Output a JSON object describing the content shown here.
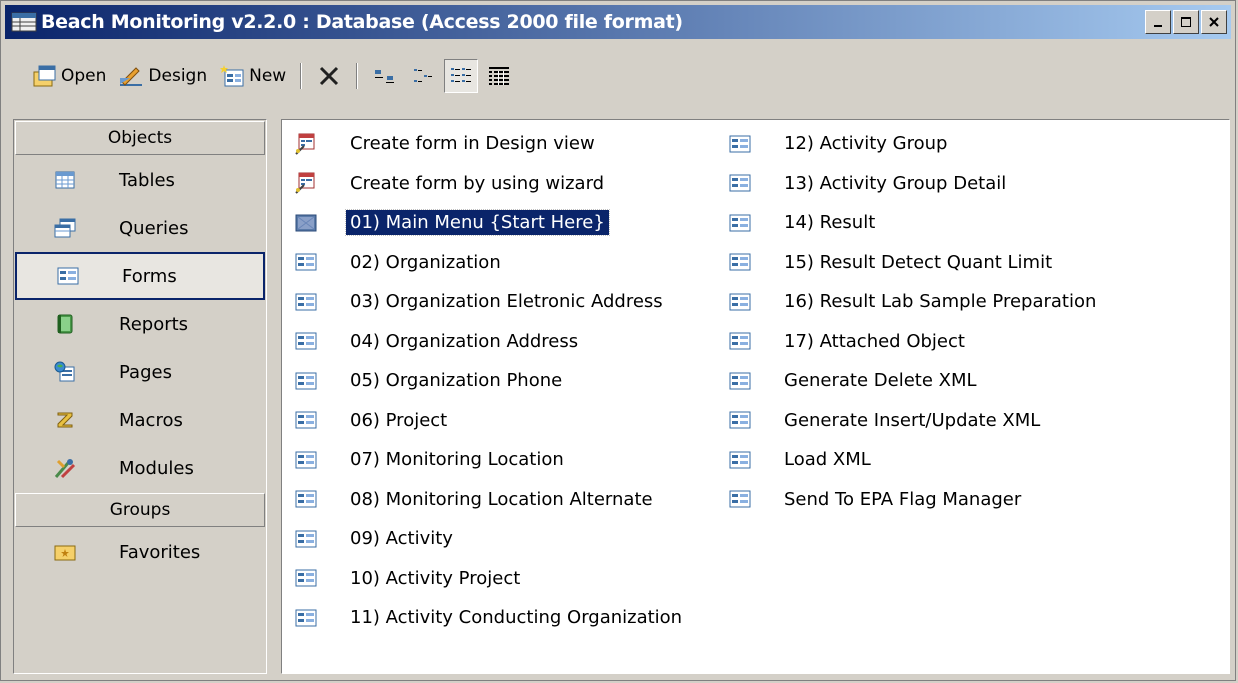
{
  "window": {
    "title": "Beach Monitoring v2.2.0 : Database (Access 2000 file format)",
    "controls": [
      "minimize",
      "maximize",
      "close"
    ]
  },
  "toolbar": {
    "open_label": "Open",
    "design_label": "Design",
    "new_label": "New",
    "icons": [
      "open-icon",
      "design-icon",
      "new-icon",
      "delete-icon",
      "large-icons-view-icon",
      "small-icons-view-icon",
      "list-view-icon",
      "details-view-icon"
    ],
    "active_view": "list"
  },
  "sidebar": {
    "objects_header": "Objects",
    "groups_header": "Groups",
    "items": [
      {
        "label": "Tables",
        "icon": "table-icon"
      },
      {
        "label": "Queries",
        "icon": "query-icon"
      },
      {
        "label": "Forms",
        "icon": "form-icon",
        "selected": true
      },
      {
        "label": "Reports",
        "icon": "report-icon"
      },
      {
        "label": "Pages",
        "icon": "page-icon"
      },
      {
        "label": "Macros",
        "icon": "macro-icon"
      },
      {
        "label": "Modules",
        "icon": "module-icon"
      }
    ],
    "groups": [
      {
        "label": "Favorites",
        "icon": "favorites-folder-icon"
      }
    ]
  },
  "list": {
    "column1": [
      {
        "label": "Create form in Design view",
        "icon": "wizard-icon"
      },
      {
        "label": "Create form by using wizard",
        "icon": "wizard-icon"
      },
      {
        "label": "01) Main Menu {Start Here}",
        "icon": "switchboard-form-icon",
        "selected": true
      },
      {
        "label": "02) Organization",
        "icon": "form-icon"
      },
      {
        "label": "03) Organization Eletronic Address",
        "icon": "form-icon"
      },
      {
        "label": "04) Organization Address",
        "icon": "form-icon"
      },
      {
        "label": "05) Organization Phone",
        "icon": "form-icon"
      },
      {
        "label": "06) Project",
        "icon": "form-icon"
      },
      {
        "label": "07) Monitoring Location",
        "icon": "form-icon"
      },
      {
        "label": "08) Monitoring Location Alternate",
        "icon": "form-icon"
      },
      {
        "label": "09) Activity",
        "icon": "form-icon"
      },
      {
        "label": "10) Activity Project",
        "icon": "form-icon"
      },
      {
        "label": "11) Activity Conducting Organization",
        "icon": "form-icon"
      }
    ],
    "column2": [
      {
        "label": "12) Activity Group",
        "icon": "form-icon"
      },
      {
        "label": "13) Activity Group Detail",
        "icon": "form-icon"
      },
      {
        "label": "14) Result",
        "icon": "form-icon"
      },
      {
        "label": "15) Result Detect Quant Limit",
        "icon": "form-icon"
      },
      {
        "label": "16) Result Lab Sample Preparation",
        "icon": "form-icon"
      },
      {
        "label": "17) Attached Object",
        "icon": "form-icon"
      },
      {
        "label": "Generate Delete XML",
        "icon": "form-icon"
      },
      {
        "label": "Generate Insert/Update XML",
        "icon": "form-icon"
      },
      {
        "label": "Load XML",
        "icon": "form-icon"
      },
      {
        "label": "Send To EPA Flag Manager",
        "icon": "form-icon"
      }
    ]
  }
}
